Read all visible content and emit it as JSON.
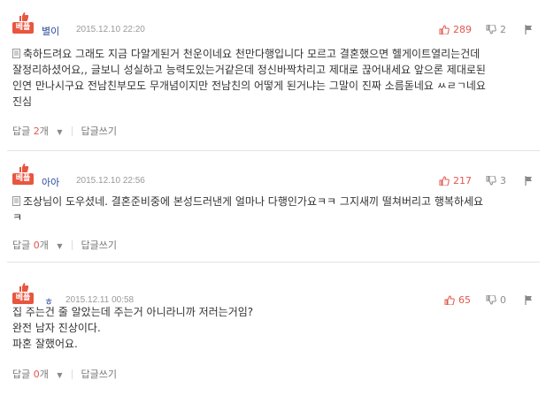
{
  "comments": [
    {
      "best_label": "베플",
      "author": "별이",
      "date": "2015.12.10 22:20",
      "likes": "289",
      "dislikes": "2",
      "lines": [
        "축하드려요 그래도 지금 다알게된거 천운이네요 천만다행입니다 모르고 결혼했으면 헬게이트열리는건데",
        "잘정리하셨어요,, 글보니 성실하고 능력도있는거같은데 정신바짝차리고 제대로 끊어내세요 앞으론 제대로된",
        "인연 만나시구요 전남친부모도 무개념이지만 전남친의 어떻게 된거냐는 그말이 진짜 소름돋네요 ㅆㄹㄱ네요",
        "진심"
      ],
      "reply_label": "답글",
      "reply_count": "2",
      "reply_unit": "개",
      "write_reply": "답글쓰기"
    },
    {
      "best_label": "베플",
      "author": "아아",
      "date": "2015.12.10 22:56",
      "likes": "217",
      "dislikes": "3",
      "lines": [
        "조상님이 도우셨네. 결혼준비중에 본성드러낸게 얼마나 다행인가요ㅋㅋ 그지새끼 떨쳐버리고 행복하세요",
        "ㅋ"
      ],
      "reply_label": "답글",
      "reply_count": "0",
      "reply_unit": "개",
      "write_reply": "답글쓰기"
    },
    {
      "best_label": "베플",
      "author": "ㅎ",
      "date": "2015.12.11 00:58",
      "likes": "65",
      "dislikes": "0",
      "lines": [
        "집 주는건 줄 알았는데 주는거 아니라니까 저러는거임?",
        "완전 남자 진상이다.",
        "파혼 잘했어요."
      ],
      "reply_label": "답글",
      "reply_count": "0",
      "reply_unit": "개",
      "write_reply": "답글쓰기"
    }
  ],
  "colors": {
    "best": "#e8563f",
    "author": "#2b4a9a",
    "likes": "#e0584e"
  },
  "icons": [
    "thumbs-up-icon",
    "thumbs-down-icon",
    "report-flag-icon",
    "document-icon",
    "dropdown-arrow-icon"
  ]
}
